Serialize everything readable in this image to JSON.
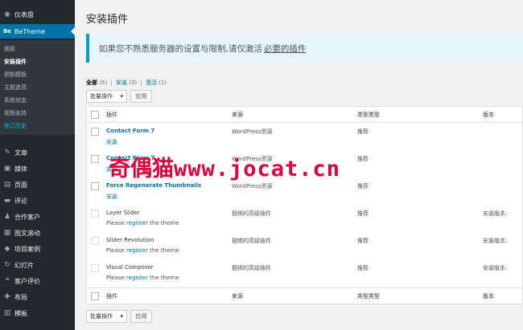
{
  "sidebar": {
    "top_items": [
      {
        "icon": "dashboard-icon",
        "glyph": "◉",
        "label": "仪表盘"
      },
      {
        "icon": "betheme-icon",
        "glyph": "Be",
        "label": "BeTheme",
        "active": true
      }
    ],
    "submenu": [
      "面板",
      "安装插件",
      "预制模板",
      "主题选项",
      "系统状态",
      "视频支持",
      "修订历史"
    ],
    "items": [
      {
        "icon": "pin-icon",
        "glyph": "✎",
        "label": "文章"
      },
      {
        "icon": "media-icon",
        "glyph": "▣",
        "label": "媒体"
      },
      {
        "icon": "page-icon",
        "glyph": "▤",
        "label": "页面"
      },
      {
        "icon": "comment-icon",
        "glyph": "▬",
        "label": "评论"
      },
      {
        "icon": "client-icon",
        "glyph": "♟",
        "label": "合作客户"
      },
      {
        "icon": "slider-icon",
        "glyph": "▦",
        "label": "图文滚动"
      },
      {
        "icon": "portfolio-icon",
        "glyph": "◆",
        "label": "项目案例"
      },
      {
        "icon": "slideshow-icon",
        "glyph": "↻",
        "label": "幻灯片"
      },
      {
        "icon": "testimonial-icon",
        "glyph": "❝",
        "label": "客户评价"
      },
      {
        "icon": "layout-icon",
        "glyph": "✚",
        "label": "布局"
      },
      {
        "icon": "template-icon",
        "glyph": "▥",
        "label": "模板"
      }
    ]
  },
  "page": {
    "title": "安装插件",
    "notice_text": "如果您不熟悉服务器的设置与限制,请仅激活",
    "notice_link": "必要的插件",
    "filters": {
      "all": "全部",
      "all_count": "(6)",
      "install": "安装",
      "install_count": "(3)",
      "activate": "激活",
      "activate_count": "(1)",
      "sep": "|"
    },
    "bulk_select": "批量操作",
    "apply_button": "应用",
    "columns": {
      "plugin": "插件",
      "source": "来源",
      "type": "类型类型",
      "version": "版本"
    }
  },
  "plugins": [
    {
      "name": "Contact Form 7",
      "action": "安装",
      "source": "WordPress资源",
      "type": "推荐",
      "version": ""
    },
    {
      "name": "Contact Form 7",
      "action": "安装",
      "source": "WordPress资源",
      "type": "推荐",
      "version": ""
    },
    {
      "name": "Force Regenerate Thumbnails",
      "action": "安装",
      "source": "WordPress资源",
      "type": "推荐",
      "version": ""
    },
    {
      "name": "Layer Slider",
      "note_pre": "Please ",
      "note_link": "register",
      "note_post": " the theme",
      "source": "捆绑的高级插件",
      "type": "推荐",
      "version": "安装版本:"
    },
    {
      "name": "Slider Revolution",
      "note_pre": "Please ",
      "note_link": "register",
      "note_post": " the theme",
      "source": "捆绑的高级插件",
      "type": "推荐",
      "version": "安装版本:"
    },
    {
      "name": "Visual Composer",
      "note_pre": "Please ",
      "note_link": "register",
      "note_post": " the theme",
      "source": "捆绑的高级插件",
      "type": "推荐",
      "version": "安装版本:"
    }
  ],
  "watermark": {
    "cn": "奇偶猫",
    "url": "www.jocat.cn"
  },
  "colors": {
    "sidebar_bg": "#23282d",
    "submenu_bg": "#32373c",
    "accent": "#0073aa",
    "watermark": "#e0003c",
    "notice_border": "#00a0d2"
  }
}
